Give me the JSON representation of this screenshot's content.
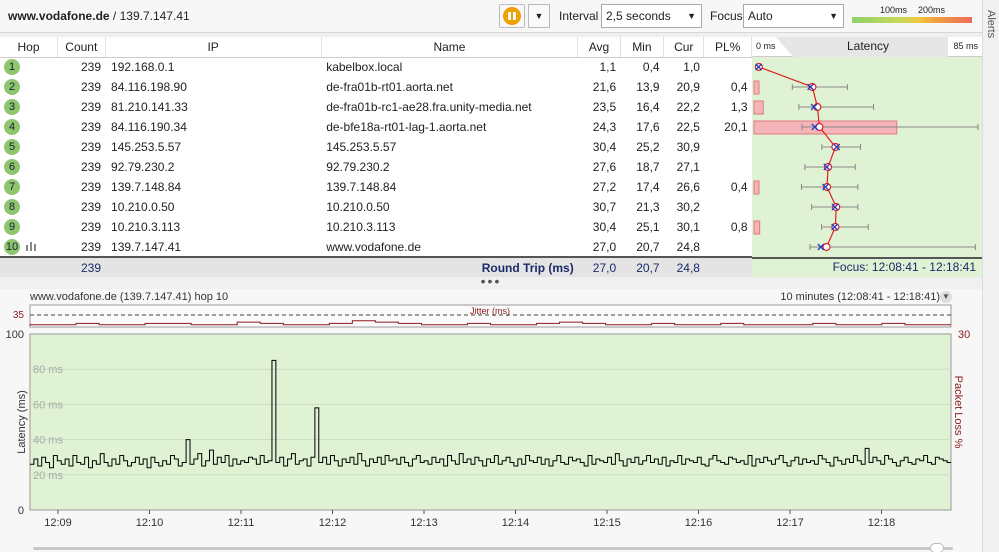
{
  "topbar": {
    "host": "www.vodafone.de",
    "separator": " / ",
    "ip": "139.7.147.41",
    "interval_label": "Interval",
    "interval_value": "2,5 seconds",
    "focus_label": "Focus",
    "focus_value": "Auto",
    "legend_100": "100ms",
    "legend_200": "200ms",
    "alerts_label": "Alerts"
  },
  "table": {
    "headers": {
      "hop": "Hop",
      "count": "Count",
      "ip": "IP",
      "name": "Name",
      "avg": "Avg",
      "min": "Min",
      "cur": "Cur",
      "pl": "PL%"
    },
    "latency_header": {
      "zero": "0 ms",
      "title": "Latency",
      "max": "85 ms"
    },
    "rows": [
      {
        "hop": "1",
        "count": "239",
        "ip": "192.168.0.1",
        "name": "kabelbox.local",
        "avg": "1,1",
        "min": "0,4",
        "cur": "1,0",
        "pl": "",
        "avg_ms": 1.1,
        "min_ms": 0.4,
        "max_ms": 1.6,
        "pl_pct": 0
      },
      {
        "hop": "2",
        "count": "239",
        "ip": "84.116.198.90",
        "name": "de-fra01b-rt01.aorta.net",
        "avg": "21,6",
        "min": "13,9",
        "cur": "20,9",
        "pl": "0,4",
        "avg_ms": 21.6,
        "min_ms": 13.9,
        "max_ms": 35,
        "pl_pct": 0.4
      },
      {
        "hop": "3",
        "count": "239",
        "ip": "81.210.141.33",
        "name": "de-fra01b-rc1-ae28.fra.unity-media.net",
        "avg": "23,5",
        "min": "16,4",
        "cur": "22,2",
        "pl": "1,3",
        "avg_ms": 23.5,
        "min_ms": 16.4,
        "max_ms": 45,
        "pl_pct": 1.3
      },
      {
        "hop": "4",
        "count": "239",
        "ip": "84.116.190.34",
        "name": "de-bfe18a-rt01-lag-1.aorta.net",
        "avg": "24,3",
        "min": "17,6",
        "cur": "22,5",
        "pl": "20,1",
        "avg_ms": 24.3,
        "min_ms": 17.6,
        "max_ms": 85,
        "pl_pct": 20.1
      },
      {
        "hop": "5",
        "count": "239",
        "ip": "145.253.5.57",
        "name": "145.253.5.57",
        "avg": "30,4",
        "min": "25,2",
        "cur": "30,9",
        "pl": "",
        "avg_ms": 30.4,
        "min_ms": 25.2,
        "max_ms": 40,
        "pl_pct": 0
      },
      {
        "hop": "6",
        "count": "239",
        "ip": "92.79.230.2",
        "name": "92.79.230.2",
        "avg": "27,6",
        "min": "18,7",
        "cur": "27,1",
        "pl": "",
        "avg_ms": 27.6,
        "min_ms": 18.7,
        "max_ms": 38,
        "pl_pct": 0
      },
      {
        "hop": "7",
        "count": "239",
        "ip": "139.7.148.84",
        "name": "139.7.148.84",
        "avg": "27,2",
        "min": "17,4",
        "cur": "26,6",
        "pl": "0,4",
        "avg_ms": 27.2,
        "min_ms": 17.4,
        "max_ms": 39,
        "pl_pct": 0.4
      },
      {
        "hop": "8",
        "count": "239",
        "ip": "10.210.0.50",
        "name": "10.210.0.50",
        "avg": "30,7",
        "min": "21,3",
        "cur": "30,2",
        "pl": "",
        "avg_ms": 30.7,
        "min_ms": 21.3,
        "max_ms": 39,
        "pl_pct": 0
      },
      {
        "hop": "9",
        "count": "239",
        "ip": "10.210.3.113",
        "name": "10.210.3.113",
        "avg": "30,4",
        "min": "25,1",
        "cur": "30,1",
        "pl": "0,8",
        "avg_ms": 30.4,
        "min_ms": 25.1,
        "max_ms": 43,
        "pl_pct": 0.8
      },
      {
        "hop": "10",
        "count": "239",
        "ip": "139.7.147.41",
        "name": "www.vodafone.de",
        "avg": "27,0",
        "min": "20,7",
        "cur": "24,8",
        "pl": "",
        "avg_ms": 27.0,
        "min_ms": 20.7,
        "max_ms": 84,
        "pl_pct": 0
      }
    ],
    "round_trip": {
      "count": "239",
      "label": "Round Trip (ms)",
      "avg": "27,0",
      "min": "20,7",
      "cur": "24,8",
      "focus": "Focus: 12:08:41 - 12:18:41"
    }
  },
  "chart": {
    "title": "www.vodafone.de (139.7.147.41) hop 10",
    "range": "10 minutes (12:08:41 - 12:18:41)",
    "jitter_label": "Jitter (ms)",
    "jitter_max": "35",
    "pl_axis_max": "30",
    "ylabel": "Latency (ms)",
    "ylabel_right": "Packet Loss %",
    "colors": {
      "background": "#dff2d3",
      "line": "#000000",
      "jitter": "#8b1a1a"
    }
  },
  "chart_data": {
    "type": "line",
    "title": "",
    "xlabel": "",
    "ylabel": "Latency (ms)",
    "ylim": [
      0,
      100
    ],
    "yticks": [
      "100",
      "80 ms",
      "60 ms",
      "40 ms",
      "20 ms",
      "0"
    ],
    "xticks": [
      "12:09",
      "12:10",
      "12:11",
      "12:12",
      "12:13",
      "12:14",
      "12:15",
      "12:16",
      "12:17",
      "12:18"
    ],
    "series": [
      {
        "values": [
          26,
          29,
          25,
          30,
          27,
          24,
          31,
          28,
          26,
          29,
          25,
          31,
          27,
          26,
          30,
          24,
          28,
          26,
          32,
          27,
          25,
          29,
          26,
          31,
          28,
          25,
          27,
          30,
          26,
          29,
          24,
          30,
          27,
          25,
          28,
          26,
          31,
          29,
          25,
          27,
          40,
          26,
          29,
          32,
          25,
          28,
          34,
          26,
          30,
          27,
          31,
          25,
          29,
          26,
          28,
          27,
          30,
          29,
          26,
          31,
          27,
          28,
          85,
          27,
          30,
          25,
          29,
          32,
          26,
          28,
          29,
          25,
          30,
          58,
          27,
          30,
          26,
          31,
          28,
          25,
          29,
          27,
          30,
          26,
          32,
          28,
          25,
          29,
          27,
          30,
          26,
          31,
          28,
          29,
          26,
          30,
          27,
          25,
          29,
          31,
          27,
          28,
          26,
          30,
          27,
          29,
          25,
          31,
          28,
          26,
          32,
          27,
          29,
          26,
          30,
          28,
          25,
          29,
          27,
          31,
          26,
          28,
          30,
          27,
          25,
          29,
          26,
          31,
          28,
          27,
          30,
          26,
          29,
          25,
          28,
          31,
          27,
          26,
          30,
          28,
          29,
          27,
          25,
          31,
          26,
          29,
          28,
          27,
          30,
          26,
          32,
          28,
          25,
          29,
          27,
          30,
          26,
          28,
          31,
          27,
          29,
          26,
          30,
          25,
          28,
          27,
          31,
          26,
          29,
          28,
          27,
          30,
          26,
          25,
          29,
          31,
          28,
          27,
          26,
          30,
          29,
          27,
          28,
          26,
          31,
          25,
          29,
          27,
          30,
          28,
          26,
          29,
          31,
          27,
          25,
          28,
          30,
          26,
          29,
          27,
          28,
          26,
          31,
          29,
          27,
          25,
          30,
          28,
          26,
          29,
          27,
          31,
          28,
          26,
          35,
          27,
          30,
          28,
          26,
          31,
          29,
          27,
          25,
          28,
          30,
          27,
          26,
          29,
          28,
          31,
          27,
          26,
          30,
          29,
          28,
          27
        ]
      }
    ],
    "jitter": [
      1,
      1,
      2,
      1,
      1,
      2,
      2,
      1,
      1,
      3,
      2,
      1,
      1,
      2,
      4,
      3,
      2,
      1,
      1,
      2,
      1,
      1,
      2,
      3,
      2,
      1,
      1,
      2,
      1,
      1,
      2,
      1,
      1,
      1,
      2,
      1,
      1,
      2,
      1,
      1
    ]
  }
}
